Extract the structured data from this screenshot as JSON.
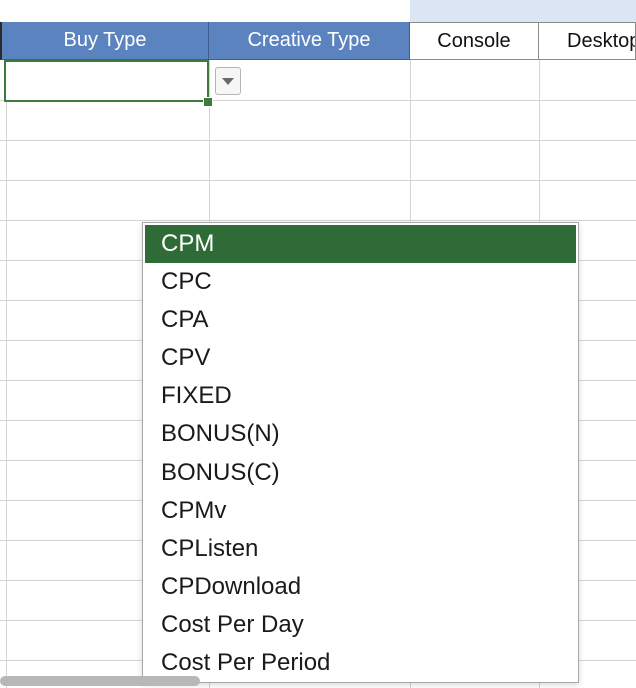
{
  "spreadsheet": {
    "columns": [
      {
        "label": "Buy Type",
        "style": "blue"
      },
      {
        "label": "Creative Type",
        "style": "blue"
      },
      {
        "label": "Console",
        "style": "plain"
      },
      {
        "label": "Desktop",
        "style": "plain"
      }
    ],
    "colors": {
      "header_blue": "#5b83c0",
      "selection_green": "#3c7a3f",
      "list_highlight": "#2e6b36"
    }
  },
  "dropdown": {
    "selected_index": 0,
    "options": [
      "CPM",
      "CPC",
      "CPA",
      "CPV",
      "FIXED",
      "BONUS(N)",
      "BONUS(C)",
      "CPMv",
      "CPListen",
      "CPDownload",
      "Cost Per Day",
      "Cost Per Period"
    ]
  },
  "icons": {
    "dropdown_button": "chevron-down-icon"
  }
}
